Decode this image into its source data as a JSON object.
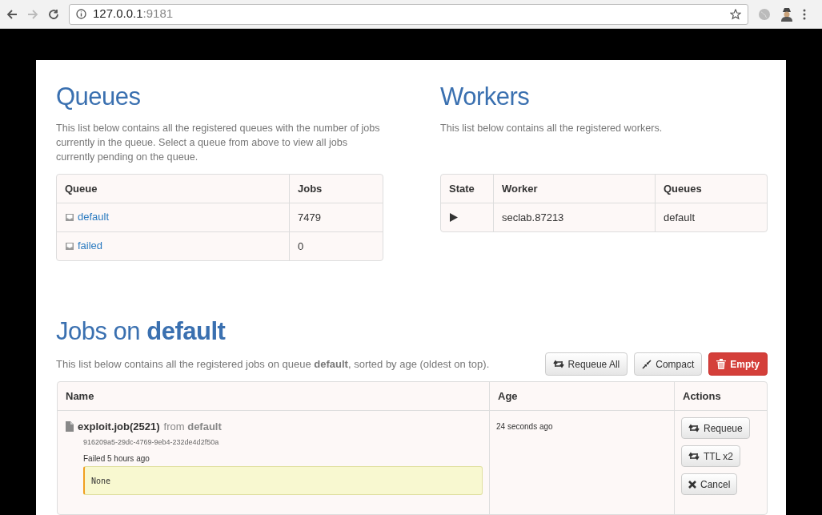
{
  "browser": {
    "host": "127.0.0.1",
    "port": ":9181"
  },
  "queues": {
    "title": "Queues",
    "description": "This list below contains all the registered queues with the number of jobs currently in the queue. Select a queue from above to view all jobs currently pending on the queue.",
    "columns": [
      "Queue",
      "Jobs"
    ],
    "rows": [
      {
        "name": "default",
        "count": "7479"
      },
      {
        "name": "failed",
        "count": "0"
      }
    ]
  },
  "workers": {
    "title": "Workers",
    "description": "This list below contains all the registered workers.",
    "columns": [
      "State",
      "Worker",
      "Queues"
    ],
    "rows": [
      {
        "running": true,
        "worker": "seclab.87213",
        "queues": "default"
      }
    ]
  },
  "jobs": {
    "title": "Jobs on **default**",
    "description": "This list below contains all the registered jobs on queue **default**, sorted by age (oldest on top).",
    "buttons": [
      {
        "label": "Requeue All",
        "kind": "requeue"
      },
      {
        "label": "Compact",
        "kind": "compact"
      },
      {
        "label": "Empty",
        "kind": "empty"
      }
    ],
    "columns": [
      "Name",
      "Age",
      "Actions"
    ],
    "rows": [
      {
        "name": "exploit.job(2521)",
        "origin": "from **default**",
        "id": "916209a5-29dc-4769-9eb4-232de4d2f50a",
        "status": "Failed 5 hours ago",
        "result": "None",
        "age": "24 seconds ago",
        "actions": [
          {
            "label": "Requeue",
            "kind": "requeue"
          },
          {
            "label": "TTL x2",
            "kind": "requeue"
          },
          {
            "label": "Cancel",
            "kind": "cancel"
          }
        ]
      }
    ]
  }
}
